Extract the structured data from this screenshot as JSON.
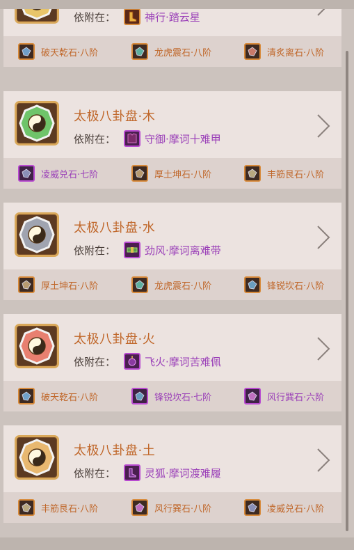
{
  "attach_label": "依附在：",
  "colors": {
    "title": "#c0672a",
    "epic": "#9a3fb8",
    "card_bg": "#ece3e0",
    "footer_bg": "#ddd2ce"
  },
  "cards": [
    {
      "title": "",
      "disk_color": "#e8c56a",
      "equip": {
        "name": "神行·踏云星",
        "rarity": "orange",
        "icon": "boots-icon"
      },
      "gems": [
        {
          "name": "破天乾石·八阶",
          "rarity": "orange",
          "color": "#6f9fc8"
        },
        {
          "name": "龙虎震石·八阶",
          "rarity": "orange",
          "color": "#5fb0a0"
        },
        {
          "name": "清炙离石·八阶",
          "rarity": "orange",
          "color": "#c87a6a"
        }
      ]
    },
    {
      "title": "太极八卦盘·木",
      "disk_color": "#6fc46a",
      "equip": {
        "name": "守御·摩诃十难甲",
        "rarity": "purple",
        "icon": "armor-icon"
      },
      "gems": [
        {
          "name": "凌威兑石·七阶",
          "rarity": "purple",
          "color": "#8a90b8"
        },
        {
          "name": "厚土坤石·八阶",
          "rarity": "orange",
          "color": "#b89a70"
        },
        {
          "name": "丰筋艮石·八阶",
          "rarity": "orange",
          "color": "#b8a880"
        }
      ]
    },
    {
      "title": "太极八卦盘·水",
      "disk_color": "#a0a4b0",
      "equip": {
        "name": "劲风·摩诃离难带",
        "rarity": "purple",
        "icon": "belt-icon"
      },
      "gems": [
        {
          "name": "厚土坤石·八阶",
          "rarity": "orange",
          "color": "#b89a70"
        },
        {
          "name": "龙虎震石·八阶",
          "rarity": "orange",
          "color": "#5fb0a0"
        },
        {
          "name": "锋锐坎石·八阶",
          "rarity": "orange",
          "color": "#6a9ec0"
        }
      ]
    },
    {
      "title": "太极八卦盘·火",
      "disk_color": "#e88070",
      "equip": {
        "name": "飞火·摩诃苦难佩",
        "rarity": "purple",
        "icon": "pendant-icon"
      },
      "gems": [
        {
          "name": "破天乾石·八阶",
          "rarity": "orange",
          "color": "#6f9fc8"
        },
        {
          "name": "锋锐坎石·七阶",
          "rarity": "purple",
          "color": "#6a9ec0"
        },
        {
          "name": "风行巽石·六阶",
          "rarity": "purple",
          "color": "#c070c0"
        }
      ]
    },
    {
      "title": "太极八卦盘·土",
      "disk_color": "#e8b870",
      "equip": {
        "name": "灵狐·摩诃渡难履",
        "rarity": "purple",
        "icon": "shoes-icon"
      },
      "gems": [
        {
          "name": "丰筋艮石·八阶",
          "rarity": "orange",
          "color": "#b8a880"
        },
        {
          "name": "风行巽石·八阶",
          "rarity": "orange",
          "color": "#c070c0"
        },
        {
          "name": "凌威兑石·八阶",
          "rarity": "orange",
          "color": "#8a90b8"
        }
      ]
    }
  ]
}
